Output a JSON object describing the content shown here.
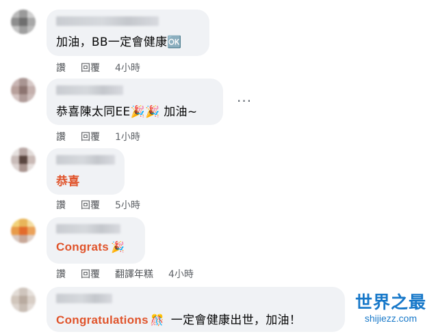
{
  "comments": [
    {
      "text": "加油，BB一定會健康🆗",
      "style": "normal",
      "actions": {
        "like": "讚",
        "reply": "回覆",
        "time": "4小時"
      }
    },
    {
      "text": "恭喜陳太同EE🎉🎉 加油~",
      "style": "normal",
      "actions": {
        "like": "讚",
        "reply": "回覆",
        "time": "1小時"
      }
    },
    {
      "text": "恭喜",
      "style": "orange",
      "actions": {
        "like": "讚",
        "reply": "回覆",
        "time": "5小時"
      }
    },
    {
      "text": "Congrats",
      "emoji": "🎉",
      "style": "orange",
      "actions": {
        "like": "讚",
        "reply": "回覆",
        "translate": "翻譯年糕",
        "time": "4小時"
      }
    },
    {
      "text": "Congratulations",
      "emoji": "🎊",
      "text_suffix": "一定會健康出世，加油！",
      "style": "orange"
    }
  ],
  "more_menu": "···",
  "watermark": {
    "title": "世界之最",
    "url": "shijiezz.com"
  },
  "colors": {
    "bubble": "#f0f2f5",
    "orange_text": "#e0532a",
    "watermark": "#1778c9"
  },
  "icons": {
    "more": "more-horizontal-icon",
    "party": "party-popper-icon",
    "confetti": "confetti-ball-icon"
  }
}
